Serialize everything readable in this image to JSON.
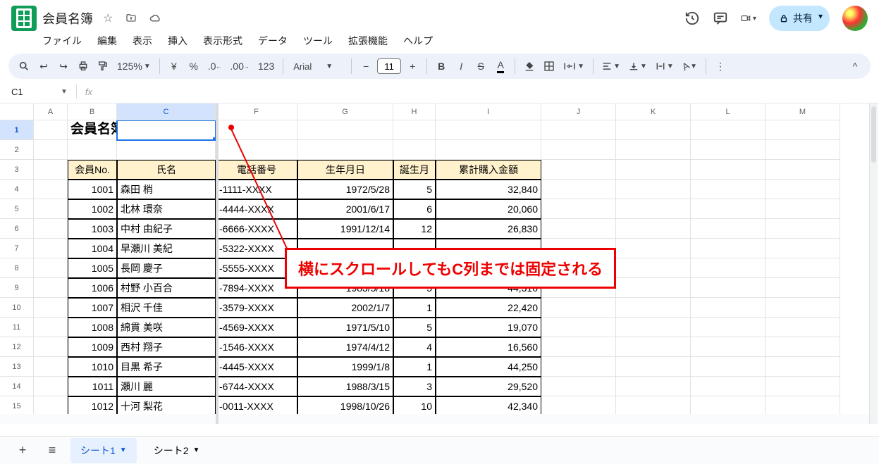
{
  "header": {
    "doc_title": "会員名簿",
    "share_label": "共有"
  },
  "menubar": [
    "ファイル",
    "編集",
    "表示",
    "挿入",
    "表示形式",
    "データ",
    "ツール",
    "拡張機能",
    "ヘルプ"
  ],
  "toolbar": {
    "zoom": "125%",
    "font": "Arial",
    "font_size": "11",
    "num_fmt": "123"
  },
  "namebox": "C1",
  "annotation": "横にスクロールしてもC列までは固定される",
  "columns": {
    "frozen": [
      "A",
      "B",
      "C"
    ],
    "scrolled": [
      "F",
      "G",
      "H",
      "I",
      "J",
      "K",
      "L",
      "M"
    ]
  },
  "rows": [
    "1",
    "2",
    "3",
    "4",
    "5",
    "6",
    "7",
    "8",
    "9",
    "10",
    "11",
    "12",
    "13",
    "14",
    "15"
  ],
  "table": {
    "title": "会員名簿",
    "headers": {
      "no": "会員No.",
      "name": "氏名",
      "phone": "電話番号",
      "dob": "生年月日",
      "bmonth": "誕生月",
      "total": "累計購入金額"
    },
    "rows": [
      {
        "no": "1001",
        "name": "森田 梢",
        "phone": "-1111-XXXX",
        "dob": "1972/5/28",
        "bmonth": "5",
        "total": "32,840"
      },
      {
        "no": "1002",
        "name": "北林 環奈",
        "phone": "-4444-XXXX",
        "dob": "2001/6/17",
        "bmonth": "6",
        "total": "20,060"
      },
      {
        "no": "1003",
        "name": "中村 由紀子",
        "phone": "-6666-XXXX",
        "dob": "1991/12/14",
        "bmonth": "12",
        "total": "26,830"
      },
      {
        "no": "1004",
        "name": "早瀬川 美紀",
        "phone": "-5322-XXXX",
        "dob": "",
        "bmonth": "",
        "total": ""
      },
      {
        "no": "1005",
        "name": "長岡 慶子",
        "phone": "-5555-XXXX",
        "dob": "",
        "bmonth": "",
        "total": ""
      },
      {
        "no": "1006",
        "name": "村野 小百合",
        "phone": "-7894-XXXX",
        "dob": "1983/5/18",
        "bmonth": "5",
        "total": "44,310"
      },
      {
        "no": "1007",
        "name": "相沢 千佳",
        "phone": "-3579-XXXX",
        "dob": "2002/1/7",
        "bmonth": "1",
        "total": "22,420"
      },
      {
        "no": "1008",
        "name": "綿貫 美咲",
        "phone": "-4569-XXXX",
        "dob": "1971/5/10",
        "bmonth": "5",
        "total": "19,070"
      },
      {
        "no": "1009",
        "name": "西村 翔子",
        "phone": "-1546-XXXX",
        "dob": "1974/4/12",
        "bmonth": "4",
        "total": "16,560"
      },
      {
        "no": "1010",
        "name": "目黒 希子",
        "phone": "-4445-XXXX",
        "dob": "1999/1/8",
        "bmonth": "1",
        "total": "44,250"
      },
      {
        "no": "1011",
        "name": "瀬川 麗",
        "phone": "-6744-XXXX",
        "dob": "1988/3/15",
        "bmonth": "3",
        "total": "29,520"
      },
      {
        "no": "1012",
        "name": "十河 梨花",
        "phone": "-0011-XXXX",
        "dob": "1998/10/26",
        "bmonth": "10",
        "total": "42,340"
      }
    ]
  },
  "tabs": [
    "シート1",
    "シート2"
  ]
}
